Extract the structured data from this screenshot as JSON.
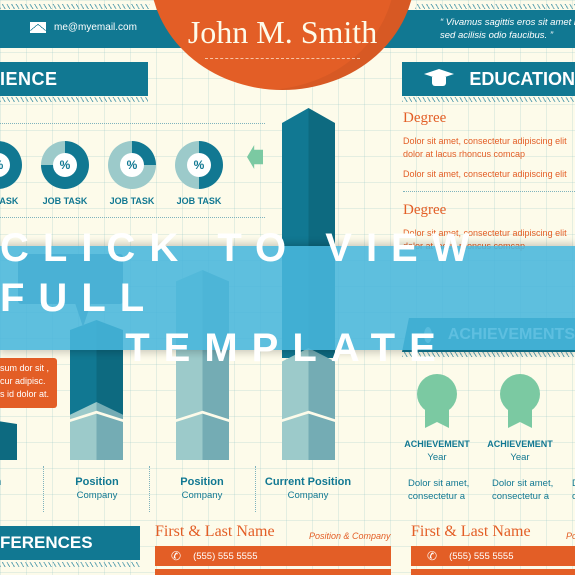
{
  "header": {
    "name": "John M. Smith",
    "email": "me@myemail.com",
    "quote_line1": "“ Vivamus sagittis eros sit amet le",
    "quote_line2": "sed acilisis odio faucibus. ”",
    "icons": {
      "email": "mail-icon"
    }
  },
  "experience": {
    "title": "IENCE",
    "job_tasks": [
      {
        "label": "B TASK",
        "percent_symbol": "%",
        "fill": 0.75
      },
      {
        "label": "JOB TASK",
        "percent_symbol": "%",
        "fill": 0.75
      },
      {
        "label": "JOB TASK",
        "percent_symbol": "%",
        "fill": 0.25
      },
      {
        "label": "JOB TASK",
        "percent_symbol": "%",
        "fill": 0.5
      }
    ],
    "orange_note": [
      "sum dor sit ,",
      "cur adipisc.",
      "s id dolor at."
    ],
    "positions": [
      {
        "title": "ion",
        "company": "ny"
      },
      {
        "title": "Position",
        "company": "Company"
      },
      {
        "title": "Position",
        "company": "Company"
      },
      {
        "title": "Current Position",
        "company": "Company"
      }
    ]
  },
  "education": {
    "title": "EDUCATION",
    "icon": "graduation-cap-icon",
    "entries": [
      {
        "degree": "Degree",
        "line1": "Dolor sit amet, consectetur adipiscing elit",
        "line2": "dolor at lacus rhoncus comcap",
        "line3": "Dolor sit amet, consectetur adipiscing elit"
      },
      {
        "degree": "Degree",
        "line1": "Dolor sit amet, consectetur adipiscing elit",
        "line2": "dolor at lacus rhoncus comcap"
      }
    ]
  },
  "achievements": {
    "title": "ACHIEVEMENTS",
    "icon": "brain-icon",
    "items": [
      {
        "title": "ACHIEVEMENT",
        "year": "Year",
        "desc1": "Dolor sit amet,",
        "desc2": "consectetur a"
      },
      {
        "title": "ACHIEVEMENT",
        "year": "Year",
        "desc1": "Dolor sit amet,",
        "desc2": "consectetur a"
      },
      {
        "title": "",
        "year": "",
        "desc1": "D",
        "desc2": "c"
      }
    ]
  },
  "references": {
    "title": "FERENCES",
    "items": [
      {
        "name": "First & Last Name",
        "position": "Position & Company",
        "phone": "(555) 555 5555"
      },
      {
        "name": "First & Last Name",
        "position": "Po",
        "phone": "(555) 555 5555"
      }
    ]
  },
  "cta": {
    "line1": "CLICK TO VIEW FULL",
    "line2": "TEMPLATE"
  },
  "colors": {
    "teal": "#117892",
    "orange": "#e35e26",
    "mint": "#7bc9a2",
    "cream": "#fdfbea",
    "overlay": "#48b6dc"
  }
}
